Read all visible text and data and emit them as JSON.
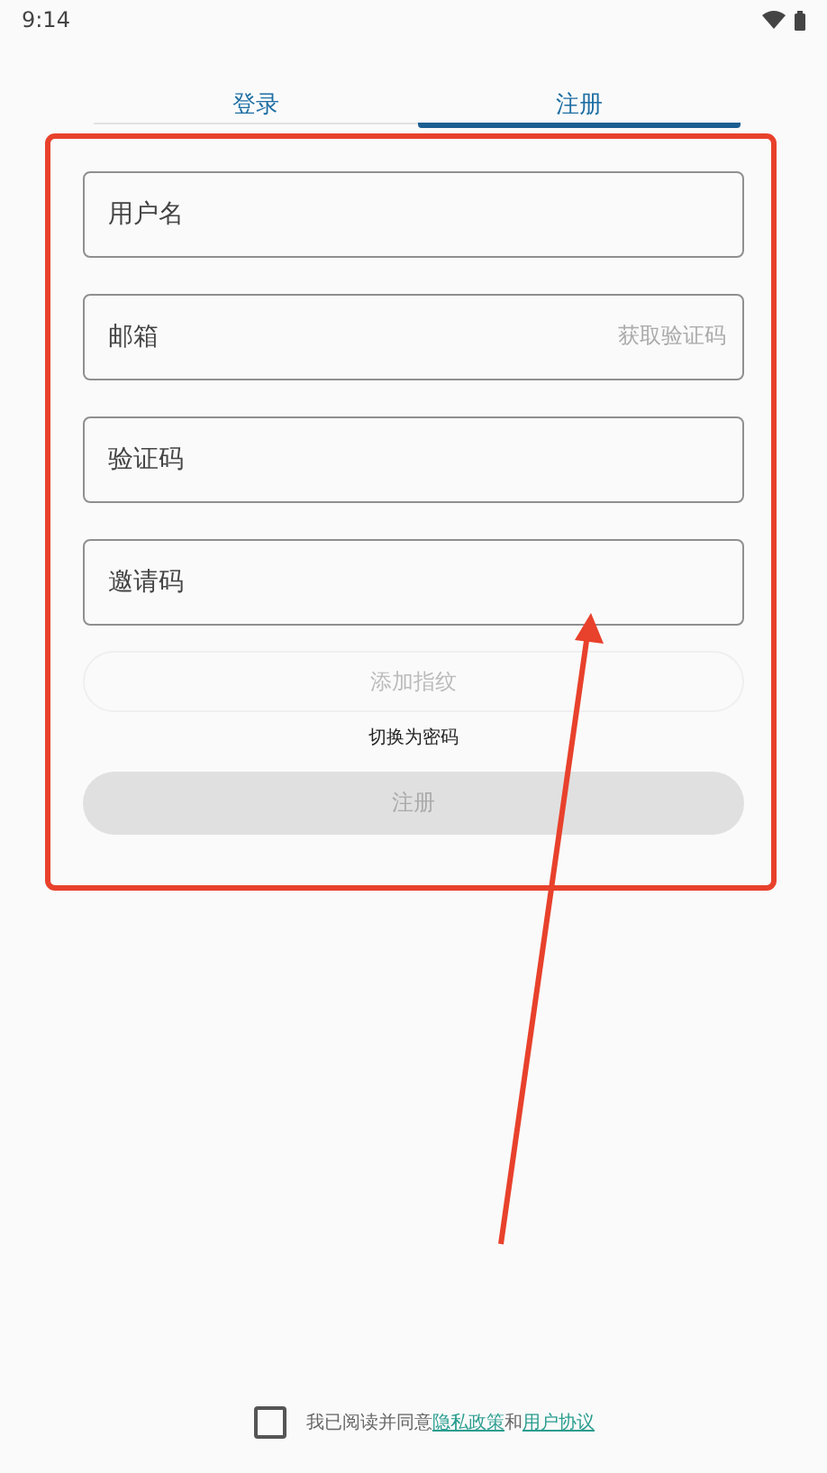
{
  "status_bar": {
    "time": "9:14"
  },
  "tabs": [
    {
      "label": "登录",
      "selected": false
    },
    {
      "label": "注册",
      "selected": true
    }
  ],
  "fields": [
    {
      "placeholder": "用户名"
    },
    {
      "placeholder": "邮箱",
      "action": "获取验证码"
    },
    {
      "placeholder": "验证码"
    },
    {
      "placeholder": "邀请码"
    }
  ],
  "fingerprint_button": {
    "label": "添加指纹",
    "disabled": true
  },
  "switch_link": "切换为密码",
  "submit_button": {
    "label": "注册",
    "disabled": true
  },
  "agreement": {
    "checked": false,
    "text": "我已阅读并同意",
    "links": [
      "隐私政策",
      "用户协议"
    ],
    "joiner": "和"
  }
}
